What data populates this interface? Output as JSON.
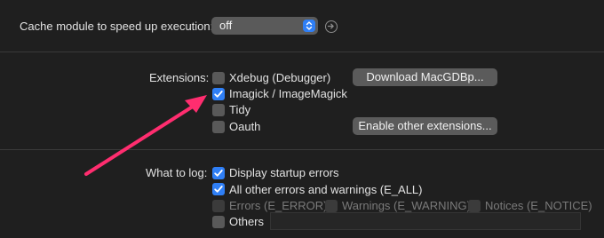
{
  "cache": {
    "label": "Cache module to speed up execution:",
    "selected": "off"
  },
  "extensions": {
    "label": "Extensions:",
    "items": [
      {
        "label": "Xdebug (Debugger)",
        "checked": false
      },
      {
        "label": "Imagick / ImageMagick",
        "checked": true
      },
      {
        "label": "Tidy",
        "checked": false
      },
      {
        "label": "Oauth",
        "checked": false
      }
    ],
    "download_button": "Download MacGDBp...",
    "enable_other_button": "Enable other extensions..."
  },
  "log": {
    "label": "What to log:",
    "options": [
      {
        "label": "Display startup errors",
        "checked": true
      },
      {
        "label": "All other errors and warnings (E_ALL)",
        "checked": true
      }
    ],
    "sub_options": [
      {
        "label": "Errors (E_ERROR)",
        "checked": false,
        "disabled": true
      },
      {
        "label": "Warnings (E_WARNING)",
        "checked": false,
        "disabled": true
      },
      {
        "label": "Notices (E_NOTICE)",
        "checked": false,
        "disabled": true
      }
    ],
    "others": {
      "label": "Others",
      "checked": false,
      "value": ""
    }
  },
  "colors": {
    "accent": "#2f7ff6",
    "annotation_arrow": "#ff2d6f",
    "background": "#1f1f1f"
  }
}
